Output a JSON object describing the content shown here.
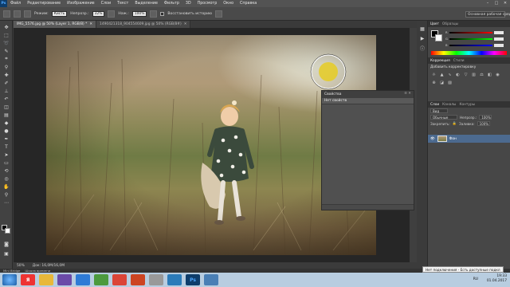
{
  "menubar": {
    "logo": "Ps",
    "items": [
      "Файл",
      "Редактирование",
      "Изображение",
      "Слои",
      "Текст",
      "Выделение",
      "Фильтр",
      "3D",
      "Просмотр",
      "Окно",
      "Справка"
    ]
  },
  "options": {
    "mode_label": "Режим:",
    "mode_value": "Кисть",
    "opacity_label": "Непрозр.:",
    "opacity_value": "32%",
    "flow_label": "Наж.:",
    "flow_value": "100%",
    "history_label": "Восстановить историю",
    "workspace": "Основная рабочая среда"
  },
  "tabs": [
    {
      "label": "IMG_5576.jpg @ 50% (Layer 1, RGB/8) *",
      "active": true
    },
    {
      "label": "1490421318_904554609.jpg @ 50% (RGB/8#)",
      "active": false
    }
  ],
  "status": {
    "zoom": "50%",
    "doc": "Док: 16,0M/16,0M"
  },
  "bridge_tabs": [
    "Mini Bridge",
    "Шкала времени"
  ],
  "properties": {
    "title": "Свойства",
    "subtitle": "Нет свойств"
  },
  "color_panel": {
    "tabs": [
      "Цвет",
      "Образцы"
    ]
  },
  "adjustments": {
    "tabs": [
      "Коррекция",
      "Стили"
    ],
    "subtitle": "Добавить корректировку"
  },
  "layers": {
    "tabs": [
      "Слои",
      "Каналы",
      "Контуры"
    ],
    "kind": "Вид",
    "blend_mode": "Обычные",
    "opacity_label": "Непрозр.:",
    "opacity_value": "100%",
    "lock_label": "Закрепить:",
    "fill_label": "Заливка:",
    "fill_value": "100%",
    "layer_name": "Фон"
  },
  "taskbar": {
    "apps": [
      "",
      "Я",
      "",
      "",
      "",
      "",
      "",
      "",
      "",
      "",
      "Ps",
      ""
    ],
    "lang": "RU",
    "time": "19:33",
    "date": "01.04.2017",
    "tooltip": "Нет подключения - Есть доступные подкл"
  },
  "colors": {
    "brush_cursor": "#e4cc2c",
    "selected_layer": "#4c6a8f"
  }
}
